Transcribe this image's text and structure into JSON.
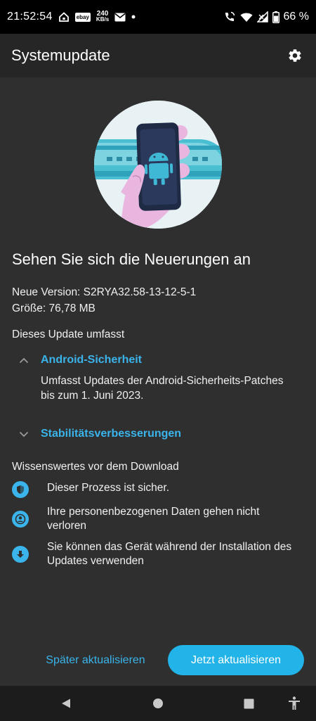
{
  "status_bar": {
    "time": "21:52:54",
    "net_speed_value": "240",
    "net_speed_unit": "KB/s",
    "ebay_label": "ebay",
    "battery": "66 %"
  },
  "app_bar": {
    "title": "Systemupdate",
    "settings_icon": "gear-icon"
  },
  "headline": "Sehen Sie sich die Neuerungen an",
  "version_line": "Neue Version: S2RYA32.58-13-12-5-1",
  "size_line": "Größe: 76,78 MB",
  "includes_title": "Dieses Update umfasst",
  "sections": [
    {
      "label": "Android-Sicherheit",
      "expanded": true,
      "body": "Umfasst Updates der Android-Sicherheits-Patches bis zum 1. Juni 2023."
    },
    {
      "label": "Stabilitätsverbesserungen",
      "expanded": false
    }
  ],
  "info_title": "Wissenswertes vor dem Download",
  "features": [
    {
      "icon": "shield-icon",
      "text": "Dieser Prozess ist sicher."
    },
    {
      "icon": "person-icon",
      "text": "Ihre personenbezogenen Daten gehen nicht verloren"
    },
    {
      "icon": "download-arrow-icon",
      "text": "Sie können das Gerät während der Installation des Updates verwenden"
    }
  ],
  "buttons": {
    "later": "Später aktualisieren",
    "now": "Jetzt aktualisieren"
  },
  "colors": {
    "accent": "#3ab4ea",
    "primary_button": "#22b3e8",
    "background": "#2f2f30",
    "app_bar": "#262627"
  }
}
